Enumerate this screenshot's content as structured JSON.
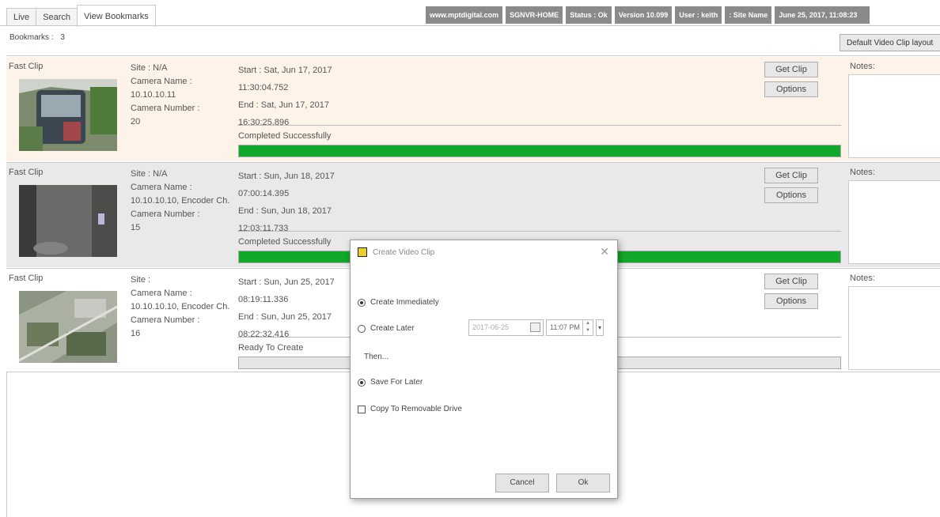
{
  "tabs": [
    "Live",
    "Search",
    "View Bookmarks"
  ],
  "status_bar": [
    "www.mptdigital.com",
    "SGNVR-HOME",
    "Status : Ok",
    "Version 10.099",
    "User : keith",
    ": Site Name",
    "June 25, 2017, 11:08:23"
  ],
  "bookmarks": {
    "label": "Bookmarks :",
    "count": "3"
  },
  "default_layout_btn": "Default Video Clip layout",
  "clips": [
    {
      "type": "Fast Clip",
      "site": "Site :  N/A",
      "camera_name_label": "Camera Name :",
      "camera_name": "10.10.10.11",
      "camera_number_label": "Camera Number :",
      "camera_number": "20",
      "start": "Start : Sat, Jun 17, 2017",
      "start_time": "11:30:04.752",
      "end": "End : Sat, Jun 17, 2017",
      "end_time": "16:30:25.896",
      "status": "Completed Successfully",
      "progress": 1.0,
      "get_clip": "Get Clip",
      "options": "Options",
      "notes": "Notes:"
    },
    {
      "type": "Fast Clip",
      "site": "Site :  N/A",
      "camera_name_label": "Camera Name :",
      "camera_name": "10.10.10.10, Encoder Ch...",
      "camera_number_label": "Camera Number :",
      "camera_number": "15",
      "start": "Start : Sun, Jun 18, 2017",
      "start_time": "07:00:14.395",
      "end": "End : Sun, Jun 18, 2017",
      "end_time": "12:03:11.733",
      "status": "Completed Successfully",
      "progress": 1.0,
      "get_clip": "Get Clip",
      "options": "Options",
      "notes": "Notes:"
    },
    {
      "type": "Fast Clip",
      "site": "Site :",
      "camera_name_label": "Camera Name :",
      "camera_name": "10.10.10.10, Encoder Ch...",
      "camera_number_label": "Camera Number :",
      "camera_number": "16",
      "start": "Start : Sun, Jun 25, 2017",
      "start_time": "08:19:11.336",
      "end": "End : Sun, Jun 25, 2017",
      "end_time": "08:22:32.416",
      "status": "Ready To Create",
      "progress": 0,
      "get_clip": "Get Clip",
      "options": "Options",
      "notes": "Notes:"
    }
  ],
  "dialog": {
    "title": "Create Video Clip",
    "create_immediately": "Create Immediately",
    "create_later": "Create Later",
    "date_value": "2017-06-25",
    "time_value": "11:07 PM",
    "then": "Then...",
    "save_for_later": "Save For Later",
    "copy_removable": "Copy To Removable Drive",
    "cancel": "Cancel",
    "ok": "Ok"
  },
  "colors": {
    "row_highlight": "#fdf3e9",
    "row_gray": "#e9e9e9",
    "progress_green": "#12a82a",
    "status_gray": "#8a8a8a"
  }
}
